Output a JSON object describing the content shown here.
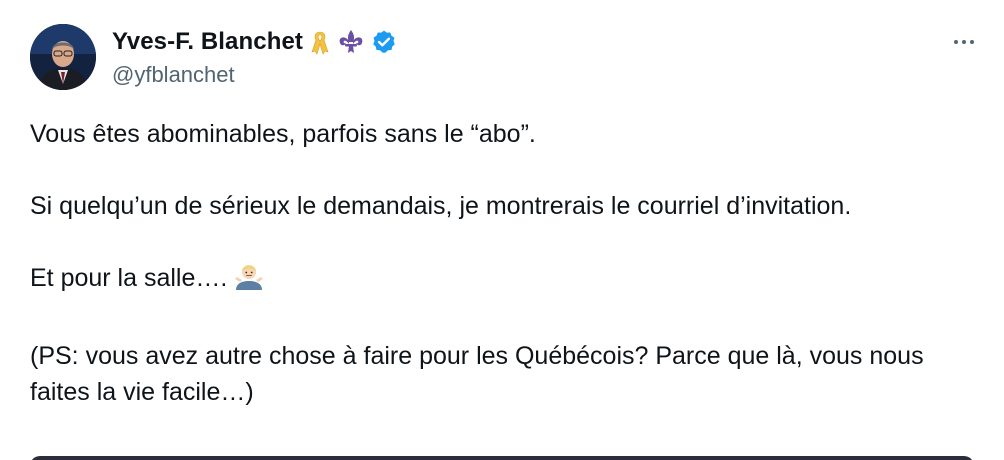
{
  "author": {
    "display_name": "Yves-F. Blanchet",
    "handle": "@yfblanchet",
    "badges": [
      "awareness-ribbon-icon",
      "fleur-de-lis-icon",
      "verified-badge-icon"
    ],
    "verified_color": "#1d9bf0"
  },
  "menu": {
    "more_icon": "more-options-icon"
  },
  "tweet": {
    "paragraphs": [
      "Vous êtes abominables, parfois sans le “abo”.",
      "Si quelqu’un de sérieux le demandais, je montrerais le courriel d’invitation.",
      "Et pour la salle….",
      "(PS: vous avez autre chose à faire pour les Québécois? Parce que là, vous nous faites la vie facile…)"
    ],
    "emoji": "person-shrugging-emoji"
  },
  "colors": {
    "text": "#0f1419",
    "secondary": "#536471",
    "accent": "#1d9bf0",
    "ribbon": "#f4c242",
    "fleur": "#6b4fa3"
  }
}
